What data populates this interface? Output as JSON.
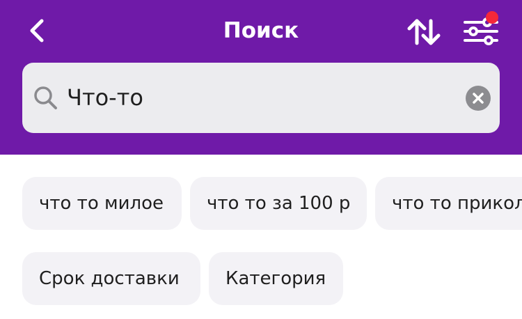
{
  "header": {
    "title": "Поиск",
    "background_color": "#6f1aa8",
    "back_icon": "chevron-left-icon",
    "sort_icon": "sort-arrows-icon",
    "filter_icon": "sliders-icon",
    "filter_has_notification": true,
    "notification_color": "#f5283a"
  },
  "search": {
    "value": "Что-то",
    "search_icon": "search-icon",
    "clear_icon": "clear-circle-icon"
  },
  "suggestions": [
    "что то милое",
    "что то за 100 р",
    "что то прикол"
  ],
  "filters": [
    "Срок доставки",
    "Категория"
  ]
}
